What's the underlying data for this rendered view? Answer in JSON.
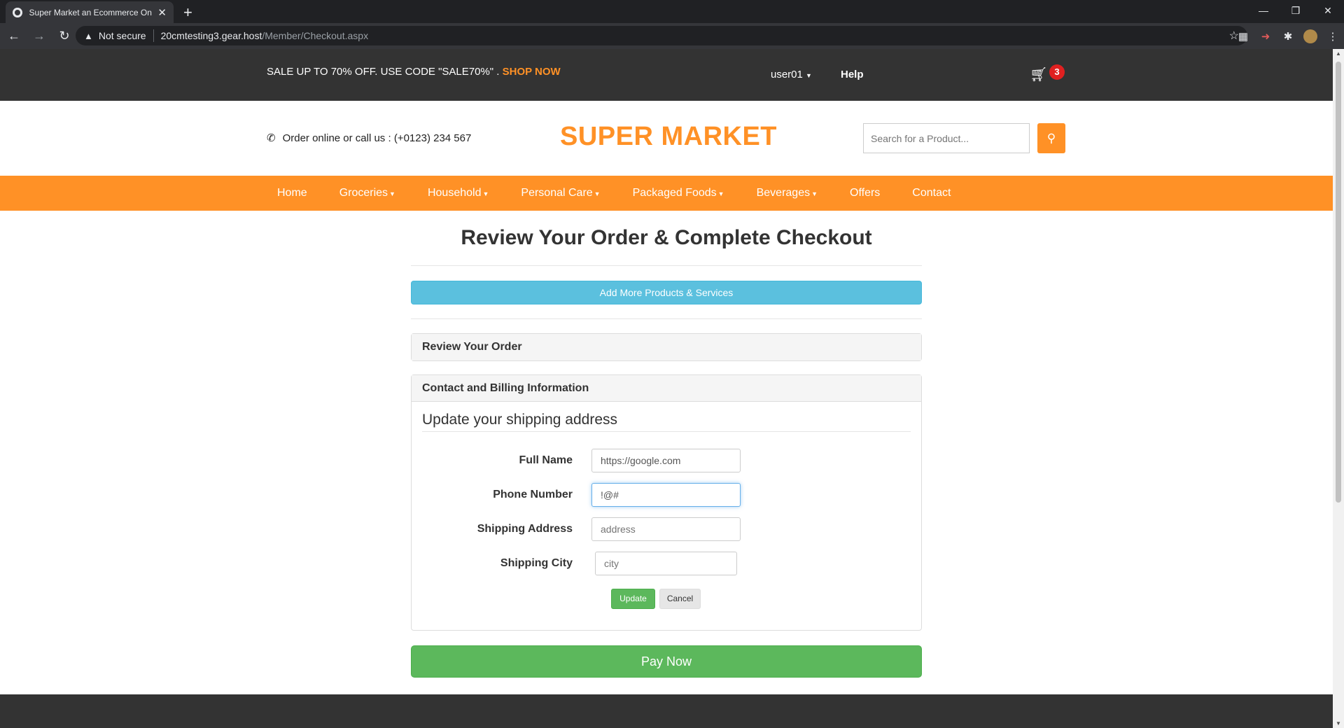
{
  "browser": {
    "tab_title": "Super Market an Ecommerce Onl",
    "tab_close": "✕",
    "new_tab": "+",
    "security_label": "Not secure",
    "url_host": "20cmtesting3.gear.host",
    "url_path": "/Member/Checkout.aspx"
  },
  "topbar": {
    "sale_text": "SALE UP TO 70% OFF. USE CODE \"SALE70%\" . ",
    "shop_now": "SHOP NOW",
    "user": "user01",
    "help": "Help",
    "cart_count": "3"
  },
  "header": {
    "phone_text": "Order online or call us : (+0123) 234 567",
    "logo": "SUPER MARKET",
    "search_placeholder": "Search for a Product..."
  },
  "menu": {
    "items": [
      "Home",
      "Groceries",
      "Household",
      "Personal Care",
      "Packaged Foods",
      "Beverages",
      "Offers",
      "Contact"
    ]
  },
  "main": {
    "title": "Review Your Order & Complete Checkout",
    "add_more": "Add More Products & Services",
    "review_panel": "Review Your Order",
    "contact_panel": "Contact and Billing Information",
    "ship_title": "Update your shipping address",
    "fields": {
      "full_name_label": "Full Name",
      "full_name_value": "https://google.com",
      "phone_label": "Phone Number",
      "phone_value": "!@#",
      "address_label": "Shipping Address",
      "address_placeholder": "address",
      "city_label": "Shipping City",
      "city_placeholder": "city"
    },
    "update": "Update",
    "cancel": "Cancel",
    "pay_now": "Pay Now"
  }
}
